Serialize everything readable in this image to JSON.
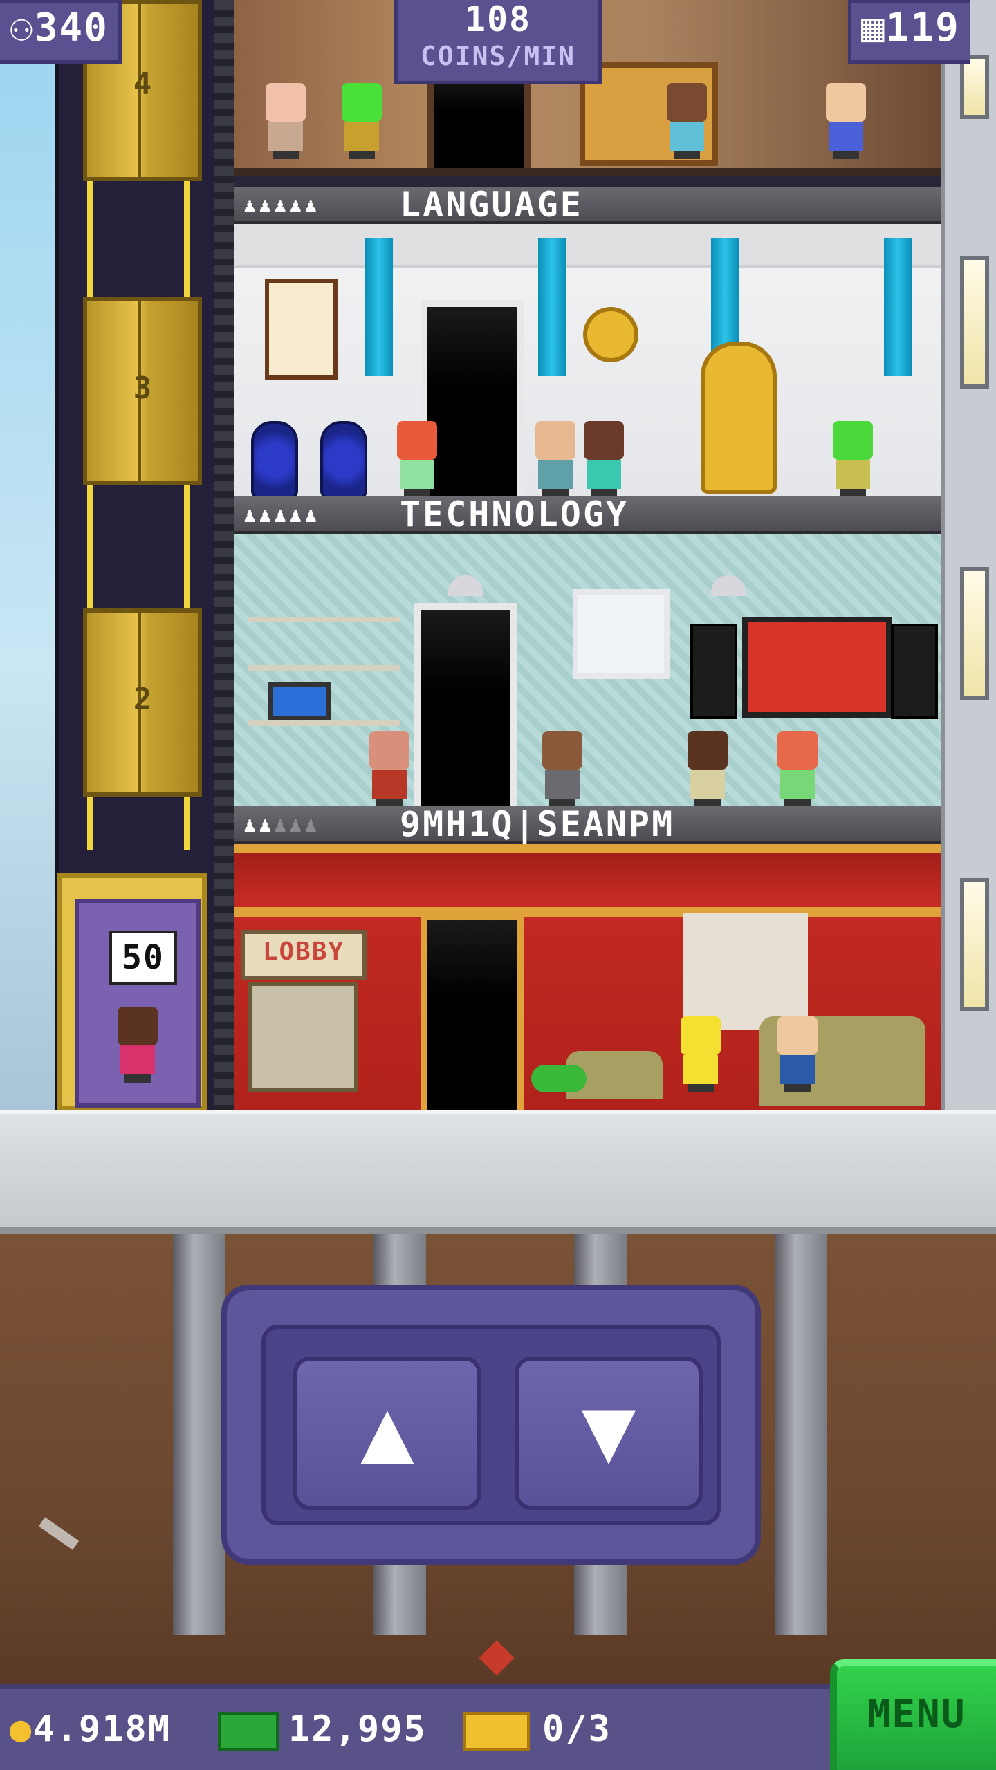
{
  "hud": {
    "population": "340",
    "coins_rate": "108",
    "coins_rate_unit": "COINS/MIN",
    "floors": "119"
  },
  "shaft": {
    "floor_numbers": [
      "4",
      "3",
      "2"
    ],
    "elevator_capacity": "50"
  },
  "floors": [
    {
      "name": "LANGUAGE",
      "residents_filled": 5,
      "residents_total": 5
    },
    {
      "name": "TECHNOLOGY",
      "residents_filled": 5,
      "residents_total": 5
    },
    {
      "name": "9MH1Q|SEANPM",
      "residents_filled": 2,
      "residents_total": 5,
      "sign": "LOBBY"
    }
  ],
  "controls": {
    "up_label": "▲",
    "down_label": "▼"
  },
  "bottom_bar": {
    "coins": "4.918M",
    "bux": "12,995",
    "tickets": "0/3",
    "menu_label": "MENU"
  },
  "colors": {
    "accent_purple": "#5a5290",
    "menu_green": "#27c043",
    "elevator_gold": "#e3c34a"
  },
  "icons": [
    "person-icon",
    "building-icon",
    "coin-icon",
    "bux-icon",
    "ticket-icon",
    "up-arrow-icon",
    "down-arrow-icon"
  ]
}
